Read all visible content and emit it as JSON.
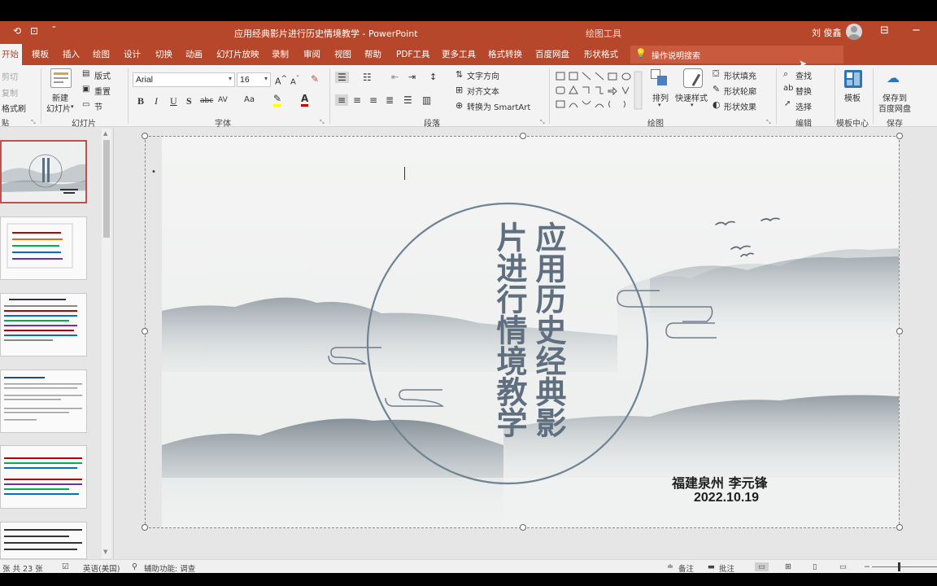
{
  "window": {
    "title": "应用经典影片进行历史情境教学 - PowerPoint",
    "context_tab_group": "绘图工具",
    "user_name": "刘 俊鑫",
    "controls": [
      "−",
      "□"
    ]
  },
  "tabs": [
    "开始",
    "模板",
    "插入",
    "绘图",
    "设计",
    "切换",
    "动画",
    "幻灯片放映",
    "录制",
    "审阅",
    "视图",
    "帮助",
    "PDF工具",
    "更多工具",
    "格式转换",
    "百度网盘",
    "形状格式"
  ],
  "search": {
    "label": "操作说明搜索",
    "icon": "lightbulb-icon"
  },
  "ribbon": {
    "clipboard": {
      "cut": "剪切",
      "copy": "复制",
      "format_painter": "格式刷"
    },
    "slides": {
      "new_slide_line1": "新建",
      "new_slide_line2": "幻灯片",
      "layout": "版式",
      "reset": "重置",
      "section": "节",
      "group": "幻灯片"
    },
    "font": {
      "name": "Arial",
      "size": "16",
      "group": "字体",
      "bold": "B",
      "italic": "I",
      "underline": "U",
      "strike": "S",
      "abc": "abc",
      "spacing": "AV",
      "case": "Aa"
    },
    "paragraph": {
      "text_direction": "文字方向",
      "align_text": "对齐文本",
      "smartart": "转换为 SmartArt",
      "group": "段落"
    },
    "drawing": {
      "arrange": "排列",
      "quick_styles": "快速样式",
      "fill": "形状填充",
      "outline": "形状轮廓",
      "effects": "形状效果",
      "group": "绘图"
    },
    "editing": {
      "find": "查找",
      "replace": "替换",
      "select": "选择",
      "group": "编辑"
    },
    "template": {
      "label": "模板",
      "group": "模板中心"
    },
    "save": {
      "line1": "保存到",
      "line2": "百度网盘",
      "group": "保存"
    }
  },
  "slide": {
    "title_col_right": "应用历史经典影",
    "title_col_left": "片进行情境教学",
    "author": "福建泉州  李元锋",
    "date": "2022.10.19"
  },
  "statusbar": {
    "slide_count": "张  共 23 张",
    "language": "英语(美国)",
    "accessibility": "辅助功能: 调查",
    "notes": "备注",
    "comments": "批注"
  },
  "colors": {
    "brand": "#b7472a",
    "title_ink": "#5f6f80"
  }
}
